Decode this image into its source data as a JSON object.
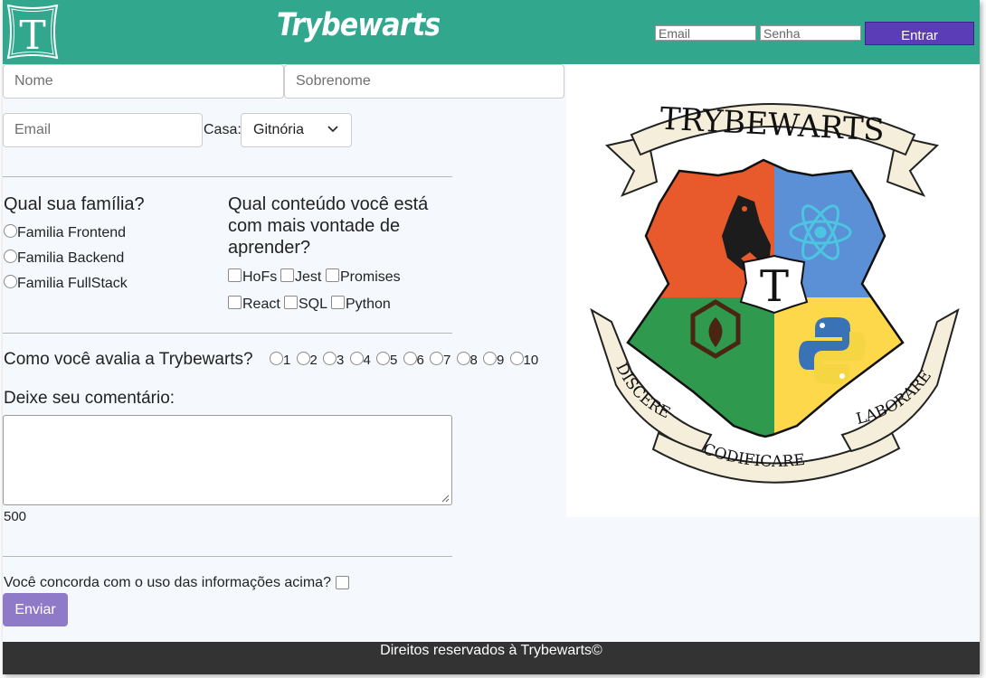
{
  "header": {
    "title": "Trybewarts",
    "logo_letter": "T",
    "email_placeholder": "Email",
    "password_placeholder": "Senha",
    "login_button": "Entrar"
  },
  "form": {
    "name_placeholder": "Nome",
    "lastname_placeholder": "Sobrenome",
    "email_placeholder": "Email",
    "house_label": "Casa:",
    "house_selected": "Gitnória",
    "family_heading": "Qual sua família?",
    "families": [
      "Familia Frontend",
      "Familia Backend",
      "Familia FullStack"
    ],
    "content_heading_lines": [
      "Qual conteúdo você está",
      "com mais vontade de",
      "aprender?"
    ],
    "subjects": [
      "HoFs",
      "Jest",
      "Promises",
      "React",
      "SQL",
      "Python"
    ],
    "rating_label": "Como você avalia a Trybewarts?",
    "ratings": [
      "1",
      "2",
      "3",
      "4",
      "5",
      "6",
      "7",
      "8",
      "9",
      "10"
    ],
    "comment_label": "Deixe seu comentário:",
    "counter": "500",
    "agreement_label": "Você concorda com o uso das informações acima?",
    "submit_button": "Enviar"
  },
  "crest": {
    "top_banner": "TRYBEWARTS",
    "left_banner": "DISCERE",
    "bottom_banner": "CODIFICARE",
    "right_banner": "LABORARE",
    "center_letter": "T",
    "colors": {
      "red": "#e85a2c",
      "blue": "#5b8fd6",
      "green": "#2f9a4e",
      "yellow": "#fcd84a",
      "ribbon": "#f5eedb"
    }
  },
  "footer": {
    "text": "Direitos reservados à Trybewarts©"
  },
  "colors": {
    "header": "#31a78e",
    "login_button": "#5c3db8",
    "submit_button": "#8f7ac8",
    "footer": "#333333"
  }
}
